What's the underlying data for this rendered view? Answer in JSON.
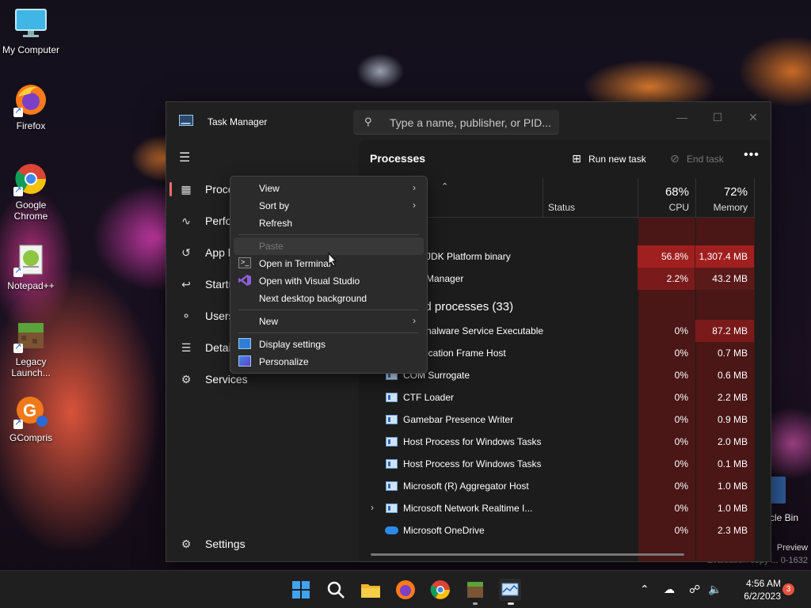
{
  "desktop": {
    "icons": [
      {
        "label": "My Computer",
        "icon": "monitor-icon"
      },
      {
        "label": "Firefox",
        "icon": "firefox-icon"
      },
      {
        "label": "Google Chrome",
        "icon": "chrome-icon"
      },
      {
        "label": "Notepad++",
        "icon": "notepadpp-icon"
      },
      {
        "label": "Legacy Launch...",
        "icon": "minecraft-block-icon"
      },
      {
        "label": "GCompris",
        "icon": "gcompris-icon"
      }
    ],
    "recycle_bin_label": "cle Bin",
    "watermark_line1": "Preview",
    "watermark_line2": "Evaluation copy ... 0-1632"
  },
  "window": {
    "title": "Task Manager",
    "search_placeholder": "Type a name, publisher, or PID...",
    "controls": {
      "minimize": "—",
      "maximize": "☐",
      "close": "✕"
    }
  },
  "sidebar": {
    "items": [
      {
        "label": "Processes",
        "visible": "Proce",
        "icon": "processes-grid-icon",
        "active": true
      },
      {
        "label": "Performance",
        "visible": "Perfo",
        "icon": "performance-icon"
      },
      {
        "label": "App history",
        "visible": "App h",
        "icon": "app-history-icon"
      },
      {
        "label": "Startup apps",
        "visible": "Startu",
        "icon": "startup-icon"
      },
      {
        "label": "Users",
        "visible": "Users",
        "icon": "users-icon"
      },
      {
        "label": "Details",
        "visible": "Detai",
        "icon": "details-list-icon"
      },
      {
        "label": "Services",
        "visible": "Services",
        "icon": "services-gear-icon"
      }
    ],
    "settings_label": "Settings"
  },
  "main": {
    "title": "Processes",
    "run_new_task": "Run new task",
    "end_task": "End task",
    "more": "•••",
    "columns": {
      "status": "Status",
      "cpu_pct": "68%",
      "cpu": "CPU",
      "mem_pct": "72%",
      "memory": "Memory"
    },
    "rows": [
      {
        "name": "JDK Platform binary",
        "cpu": "56.8%",
        "mem": "1,307.4 MB"
      },
      {
        "name": "Manager",
        "cpu": "2.2%",
        "mem": "43.2 MB"
      }
    ],
    "background_group": "nd processes (33)",
    "bg_rows": [
      {
        "name": "nalware Service Executable",
        "cpu": "0%",
        "mem": "87.2 MB"
      },
      {
        "name": "ication Frame Host",
        "cpu": "0%",
        "mem": "0.7 MB"
      },
      {
        "name": "COM Surrogate",
        "cpu": "0%",
        "mem": "0.6 MB"
      },
      {
        "name": "CTF Loader",
        "cpu": "0%",
        "mem": "2.2 MB"
      },
      {
        "name": "Gamebar Presence Writer",
        "cpu": "0%",
        "mem": "0.9 MB"
      },
      {
        "name": "Host Process for Windows Tasks",
        "cpu": "0%",
        "mem": "2.0 MB"
      },
      {
        "name": "Host Process for Windows Tasks",
        "cpu": "0%",
        "mem": "0.1 MB"
      },
      {
        "name": "Microsoft (R) Aggregator Host",
        "cpu": "0%",
        "mem": "1.0 MB"
      },
      {
        "name": "Microsoft Network Realtime I...",
        "cpu": "0%",
        "mem": "1.0 MB"
      },
      {
        "name": "Microsoft OneDrive",
        "cpu": "0%",
        "mem": "2.3 MB"
      }
    ]
  },
  "context_menu": {
    "view": "View",
    "sort_by": "Sort by",
    "refresh": "Refresh",
    "paste": "Paste",
    "open_terminal": "Open in Terminal",
    "open_vs": "Open with Visual Studio",
    "next_bg": "Next desktop background",
    "new": "New",
    "display_settings": "Display settings",
    "personalize": "Personalize",
    "submenu_arrow": "›"
  },
  "taskbar": {
    "apps": [
      "start-icon",
      "search-icon",
      "file-explorer-icon",
      "firefox-icon",
      "chrome-icon",
      "minecraft-icon",
      "task-manager-icon"
    ],
    "time": "4:56 AM",
    "date": "6/2/2023",
    "notifications": "3"
  },
  "colors": {
    "cpu_high": "#a0201f",
    "cpu_mid": "#7a1a1a",
    "cpu_low": "#4a1616",
    "accent": "#f06a6a"
  }
}
